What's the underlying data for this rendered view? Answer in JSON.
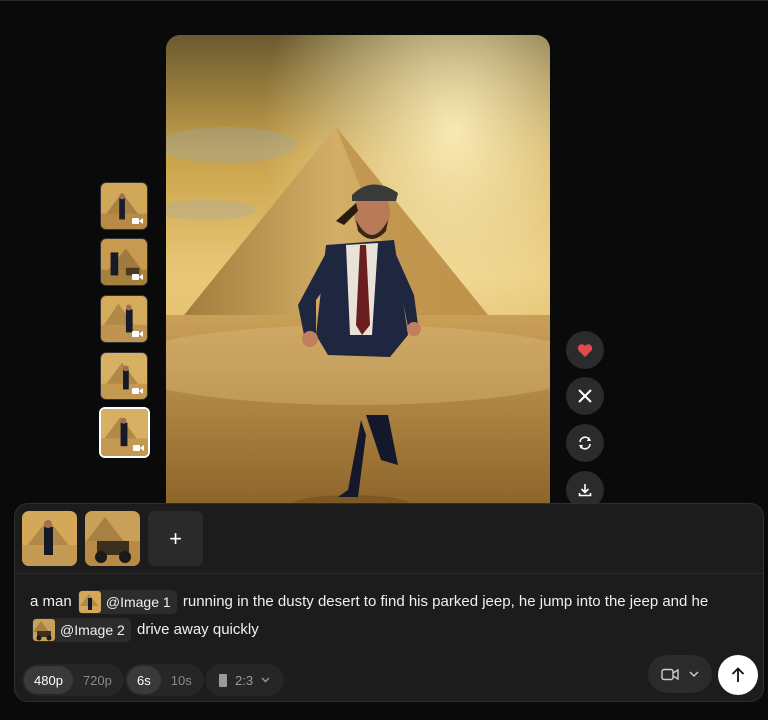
{
  "gallery": {
    "thumbnails": [
      {
        "index": 1,
        "icon": "video-icon",
        "selected": false
      },
      {
        "index": 2,
        "icon": "video-icon",
        "selected": false
      },
      {
        "index": 3,
        "icon": "video-icon",
        "selected": false
      },
      {
        "index": 4,
        "icon": "video-icon",
        "selected": false
      },
      {
        "index": 5,
        "icon": "video-icon",
        "selected": true
      }
    ]
  },
  "actions": [
    {
      "name": "like",
      "icon": "heart-icon",
      "color": "#e04a4a"
    },
    {
      "name": "share-x",
      "icon": "x-logo-icon"
    },
    {
      "name": "regenerate",
      "icon": "refresh-icon"
    },
    {
      "name": "download",
      "icon": "download-icon"
    }
  ],
  "composer": {
    "references": [
      {
        "name": "Image 1"
      },
      {
        "name": "Image 2"
      }
    ],
    "add_label": "+",
    "prompt": {
      "part1": "a man",
      "chip1": "@Image 1",
      "part2": "running in the dusty desert to find his parked jeep, he jump into the jeep and he",
      "chip2": "@Image 2",
      "part3": "drive away quickly"
    },
    "resolution": {
      "options": [
        "480p",
        "720p"
      ],
      "selected": "480p"
    },
    "duration": {
      "options": [
        "6s",
        "10s"
      ],
      "selected": "6s"
    },
    "aspect_ratio": "2:3",
    "mode_icon": "video-camera-icon",
    "send_icon": "arrow-up-icon"
  },
  "colors": {
    "background": "#0a0a0a",
    "panel": "#1c1c1c",
    "accent_heart": "#e04a4a"
  }
}
